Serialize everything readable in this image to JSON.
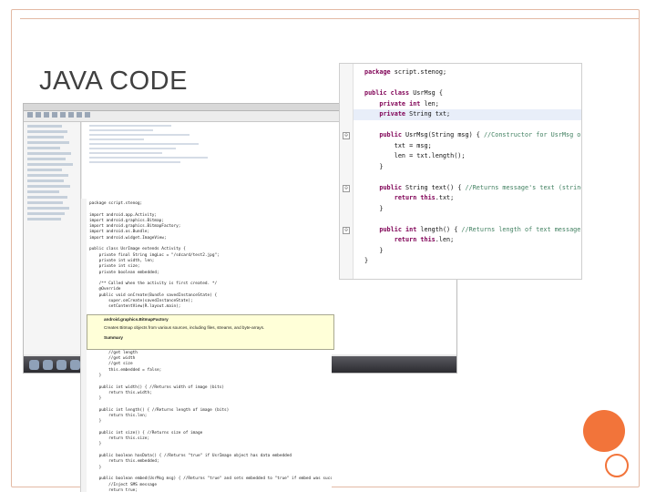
{
  "slide": {
    "title": "JAVA CODE"
  },
  "code_panel": {
    "lines": [
      {
        "parts": [
          {
            "t": "package",
            "k": "kw"
          },
          {
            "t": " script.stenog;"
          }
        ]
      },
      {
        "parts": [
          {
            "t": ""
          }
        ]
      },
      {
        "parts": [
          {
            "t": "public class",
            "k": "kw"
          },
          {
            "t": " UsrMsg {"
          }
        ]
      },
      {
        "parts": [
          {
            "t": "    "
          },
          {
            "t": "private int",
            "k": "kw"
          },
          {
            "t": " len;"
          }
        ]
      },
      {
        "parts": [
          {
            "t": "    "
          },
          {
            "t": "private",
            "k": "kw"
          },
          {
            "t": " String txt;"
          }
        ],
        "highlight": true
      },
      {
        "parts": [
          {
            "t": ""
          }
        ]
      },
      {
        "parts": [
          {
            "t": "    "
          },
          {
            "t": "public",
            "k": "kw"
          },
          {
            "t": " UsrMsg(String msg) { "
          },
          {
            "t": "//Constructor for UsrMsg object",
            "k": "cm"
          }
        ]
      },
      {
        "parts": [
          {
            "t": "        txt = msg;"
          }
        ]
      },
      {
        "parts": [
          {
            "t": "        len = txt.length();"
          }
        ]
      },
      {
        "parts": [
          {
            "t": "    }"
          }
        ]
      },
      {
        "parts": [
          {
            "t": ""
          }
        ]
      },
      {
        "parts": [
          {
            "t": "    "
          },
          {
            "t": "public",
            "k": "kw"
          },
          {
            "t": " String text() { "
          },
          {
            "t": "//Returns message's text (string)",
            "k": "cm"
          }
        ]
      },
      {
        "parts": [
          {
            "t": "        "
          },
          {
            "t": "return this",
            "k": "kw"
          },
          {
            "t": ".txt;"
          }
        ]
      },
      {
        "parts": [
          {
            "t": "    }"
          }
        ]
      },
      {
        "parts": [
          {
            "t": ""
          }
        ]
      },
      {
        "parts": [
          {
            "t": "    "
          },
          {
            "t": "public int",
            "k": "kw"
          },
          {
            "t": " length() { "
          },
          {
            "t": "//Returns length of text message",
            "k": "cm"
          }
        ]
      },
      {
        "parts": [
          {
            "t": "        "
          },
          {
            "t": "return this",
            "k": "kw"
          },
          {
            "t": ".len;"
          }
        ]
      },
      {
        "parts": [
          {
            "t": "    }"
          }
        ]
      },
      {
        "parts": [
          {
            "t": "}"
          }
        ]
      }
    ]
  },
  "middle_code": "package script.stenog;\n\nimport android.app.Activity;\nimport android.graphics.Bitmap;\nimport android.graphics.BitmapFactory;\nimport android.os.Bundle;\nimport android.widget.ImageView;\n\npublic class UsrImage extends Activity {\n    private final String imgLoc = \"/sdcard/test2.jpg\";\n    private int width, len;\n    private int size;\n    private boolean embedded;\n\n    /** Called when the activity is first created. */\n    @Override\n    public void onCreate(Bundle savedInstanceState) {\n        super.onCreate(savedInstanceState);\n        setContentView(R.layout.main);\n\n        Bitmap image = BitmapFactory.decodeFile(imgLoc);\n        ImageView imgView = (ImageView) findViewById(R.id.imgView);\n        imgView.setImageBitmap(image);\n    }\n\n    public UsrImage() {\n        //get length\n        //get width\n        //get size\n        this.embedded = false;\n    }\n\n    public int width() { //Returns width of image (bits)\n        return this.width;\n    }\n\n    public int length() { //Returns length of image (bits)\n        return this.len;\n    }\n\n    public int size() { //Returns size of image\n        return this.size;\n    }\n\n    public boolean hasData() { //Returns \"true\" if UsrImage object has data embedded\n        return this.embedded;\n    }\n\n    public boolean embed(UsrMsg msg) { //Returns \"true\" and sets embedded to \"true\" if embed was successful; else returns false\n        //Inject SMS message\n        return true;\n    }\n}",
  "tooltip": {
    "title": "android.graphics.BitmapFactory",
    "description": "Creates Bitmap objects from various sources, including files, streams, and byte-arrays.",
    "summary": "Summary"
  }
}
